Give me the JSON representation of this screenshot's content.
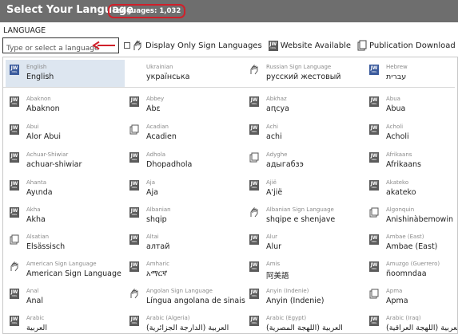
{
  "header": {
    "title": "Select Your Language",
    "count_badge": "Languages: 1,032"
  },
  "section": {
    "label": "LANGUAGE"
  },
  "search": {
    "placeholder": "Type or select a language",
    "value": ""
  },
  "filters": {
    "sign_languages": "Display Only Sign Languages",
    "website_available": "Website Available",
    "publication_download": "Publication Download Only"
  },
  "rows": [
    [
      {
        "sub": "English",
        "main": "English",
        "icon": "jw-logo-icon",
        "selected": true
      },
      {
        "sub": "Ukrainian",
        "main": "українська",
        "icon": "none"
      },
      {
        "sub": "Russian Sign Language",
        "main": "русский жестовый",
        "icon": "sign-language-icon"
      },
      {
        "sub": "Hebrew",
        "main": "עברית",
        "icon": "jw-logo-icon"
      }
    ],
    [
      {
        "sub": "Abaknon",
        "main": "Abaknon",
        "icon": "jw-logo-icon"
      },
      {
        "sub": "Abbey",
        "main": "Abɛ",
        "icon": "jw-logo-icon"
      },
      {
        "sub": "Abkhaz",
        "main": "аԥсуа",
        "icon": "jw-logo-icon"
      },
      {
        "sub": "Abua",
        "main": "Abua",
        "icon": "jw-logo-icon"
      }
    ],
    [
      {
        "sub": "Abui",
        "main": "Alor Abui",
        "icon": "jw-logo-icon"
      },
      {
        "sub": "Acadian",
        "main": "Acadien",
        "icon": "publication-icon"
      },
      {
        "sub": "Achi",
        "main": "achi",
        "icon": "jw-logo-icon"
      },
      {
        "sub": "Acholi",
        "main": "Acholi",
        "icon": "jw-logo-icon"
      }
    ],
    [
      {
        "sub": "Achuar-Shiwiar",
        "main": "achuar-shiwiar",
        "icon": "jw-logo-icon"
      },
      {
        "sub": "Adhola",
        "main": "Dhopadhola",
        "icon": "jw-logo-icon"
      },
      {
        "sub": "Adyghe",
        "main": "адыгабзэ",
        "icon": "publication-icon"
      },
      {
        "sub": "Afrikaans",
        "main": "Afrikaans",
        "icon": "jw-logo-icon"
      }
    ],
    [
      {
        "sub": "Ahanta",
        "main": "Ayɩnda",
        "icon": "jw-logo-icon"
      },
      {
        "sub": "Aja",
        "main": "Aja",
        "icon": "jw-logo-icon"
      },
      {
        "sub": "Ajië",
        "main": "A'jië",
        "icon": "jw-logo-icon"
      },
      {
        "sub": "Akateko",
        "main": "akateko",
        "icon": "jw-logo-icon"
      }
    ],
    [
      {
        "sub": "Akha",
        "main": "Akha",
        "icon": "jw-logo-icon"
      },
      {
        "sub": "Albanian",
        "main": "shqip",
        "icon": "jw-logo-icon"
      },
      {
        "sub": "Albanian Sign Language",
        "main": "shqipe e shenjave",
        "icon": "sign-language-icon"
      },
      {
        "sub": "Algonquin",
        "main": "Anishinàbemowin",
        "icon": "publication-icon"
      }
    ],
    [
      {
        "sub": "Alsatian",
        "main": "Elsässisch",
        "icon": "publication-icon"
      },
      {
        "sub": "Altai",
        "main": "алтай",
        "icon": "jw-logo-icon"
      },
      {
        "sub": "Alur",
        "main": "Alur",
        "icon": "jw-logo-icon"
      },
      {
        "sub": "Ambae (East)",
        "main": "Ambae (East)",
        "icon": "jw-logo-icon"
      }
    ],
    [
      {
        "sub": "American Sign Language",
        "main": "American Sign Language",
        "icon": "sign-language-icon"
      },
      {
        "sub": "Amharic",
        "main": "አማርኛ",
        "icon": "jw-logo-icon"
      },
      {
        "sub": "Amis",
        "main": "阿美語",
        "icon": "jw-logo-icon"
      },
      {
        "sub": "Amuzgo (Guerrero)",
        "main": "ñoomndaa",
        "icon": "jw-logo-icon"
      }
    ],
    [
      {
        "sub": "Anal",
        "main": "Anal",
        "icon": "jw-logo-icon"
      },
      {
        "sub": "Angolan Sign Language",
        "main": "Língua angolana de sinais",
        "icon": "sign-language-icon"
      },
      {
        "sub": "Anyin (Indenie)",
        "main": "Anyin (Indenie)",
        "icon": "jw-logo-icon"
      },
      {
        "sub": "Apma",
        "main": "Apma",
        "icon": "publication-icon"
      }
    ],
    [
      {
        "sub": "Arabic",
        "main": "العربية",
        "icon": "jw-logo-icon"
      },
      {
        "sub": "Arabic (Algeria)",
        "main": "العربية (الدارجة الجزائرية)",
        "icon": "jw-logo-icon"
      },
      {
        "sub": "Arabic (Egypt)",
        "main": "العربية (اللهجة المصرية)",
        "icon": "jw-logo-icon"
      },
      {
        "sub": "Arabic (Iraq)",
        "main": "العربية (اللهجة العراقية)",
        "icon": "jw-logo-icon"
      }
    ]
  ]
}
